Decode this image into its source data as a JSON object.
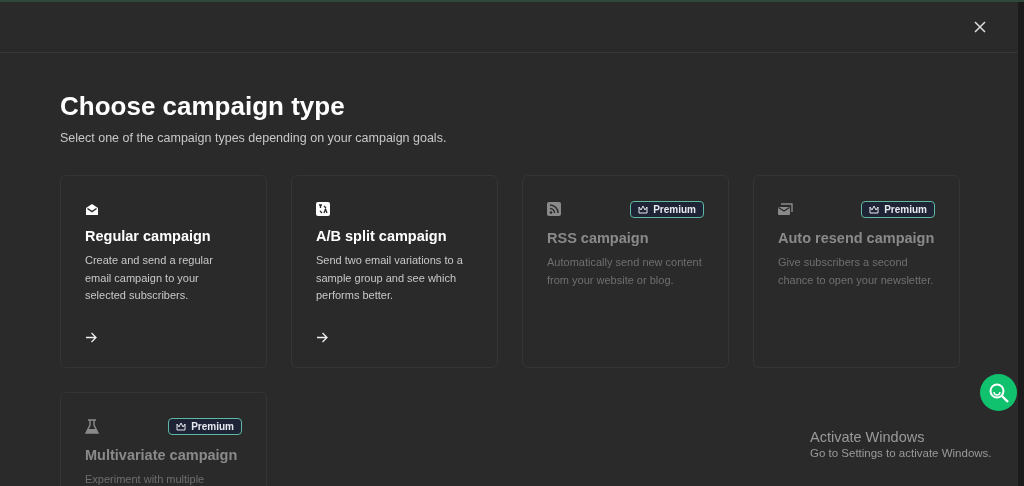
{
  "dialog": {
    "title": "Choose campaign type",
    "subtitle": "Select one of the campaign types depending on your campaign goals."
  },
  "cards": [
    {
      "kind": "mail",
      "title": "Regular campaign",
      "description": "Create and send a regular email campaign to your selected subscribers.",
      "locked": false
    },
    {
      "kind": "ab",
      "title": "A/B split campaign",
      "description": "Send two email variations to a sample group and see which performs better.",
      "locked": false
    },
    {
      "kind": "rss",
      "title": "RSS campaign",
      "description": "Automatically send new content from your website or blog.",
      "locked": true,
      "badge": "Premium"
    },
    {
      "kind": "resend",
      "title": "Auto resend campaign",
      "description": "Give subscribers a second chance to open your newsletter.",
      "locked": true,
      "badge": "Premium"
    },
    {
      "kind": "flask",
      "title": "Multivariate campaign",
      "description": "Experiment with multiple",
      "locked": true,
      "badge": "Premium"
    }
  ],
  "os_notice": {
    "title": "Activate Windows",
    "text": "Go to Settings to activate Windows."
  }
}
